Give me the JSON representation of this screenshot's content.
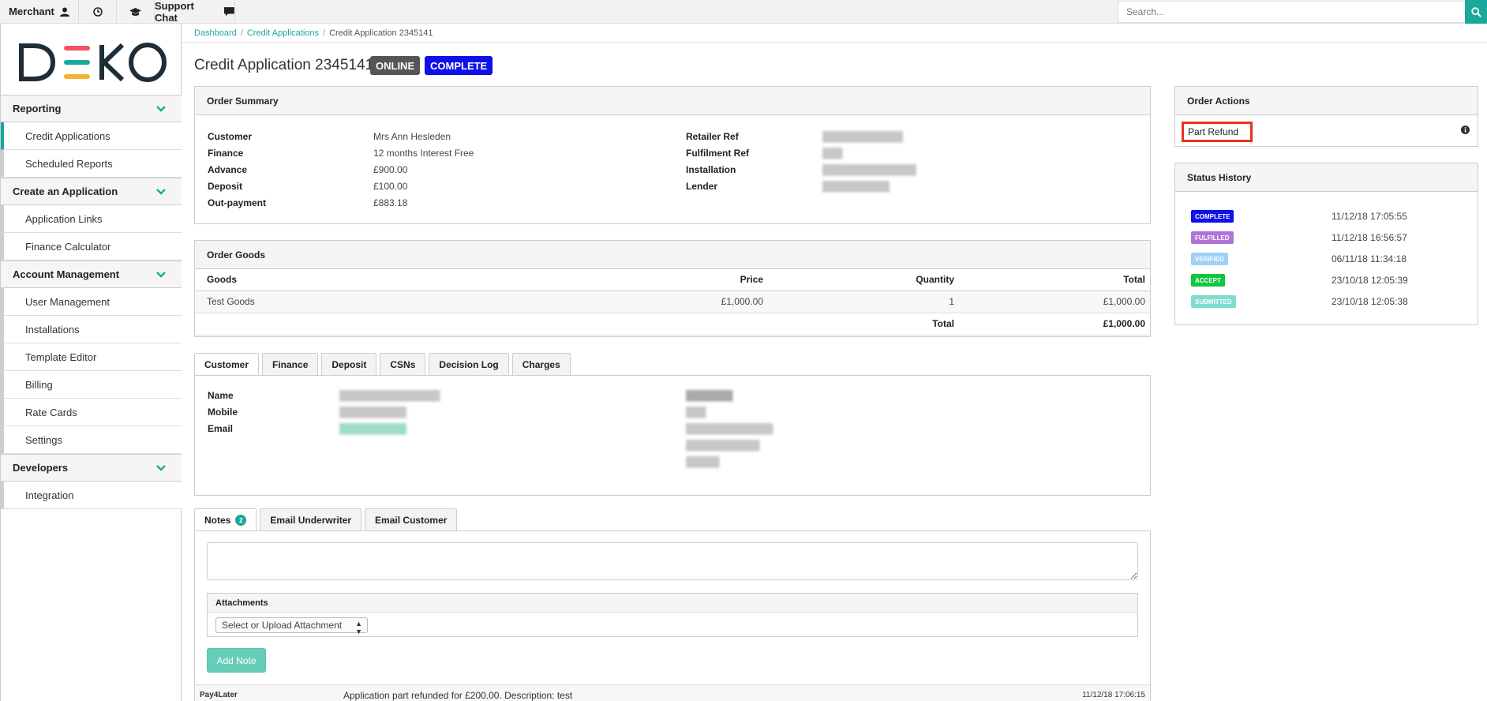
{
  "topbar": {
    "merchant_label": "Merchant",
    "support_chat_label": "Support Chat",
    "search_placeholder": "Search..."
  },
  "sidebar": {
    "logo_text": "DEKO",
    "groups": [
      {
        "label": "Reporting",
        "items": [
          "Credit Applications",
          "Scheduled Reports"
        ]
      },
      {
        "label": "Create an Application",
        "items": [
          "Application Links",
          "Finance Calculator"
        ]
      },
      {
        "label": "Account Management",
        "items": [
          "User Management",
          "Installations",
          "Template Editor",
          "Billing",
          "Rate Cards",
          "Settings"
        ]
      },
      {
        "label": "Developers",
        "items": [
          "Integration"
        ]
      }
    ],
    "active_item": "Credit Applications"
  },
  "breadcrumb": {
    "items": [
      "Dashboard",
      "Credit Applications",
      "Credit Application 2345141"
    ],
    "separator": "/"
  },
  "page": {
    "title": "Credit Application 2345141",
    "badges": [
      "ONLINE",
      "COMPLETE"
    ]
  },
  "order_summary": {
    "title": "Order Summary",
    "left": [
      {
        "label": "Customer",
        "value": "Mrs Ann Hesleden"
      },
      {
        "label": "Finance",
        "value": "12 months Interest Free"
      },
      {
        "label": "Advance",
        "value": "£900.00"
      },
      {
        "label": "Deposit",
        "value": "£100.00"
      },
      {
        "label": "Out-payment",
        "value": "£883.18"
      }
    ],
    "right": [
      {
        "label": "Retailer Ref"
      },
      {
        "label": "Fulfilment Ref"
      },
      {
        "label": "Installation"
      },
      {
        "label": "Lender"
      }
    ]
  },
  "order_goods": {
    "title": "Order Goods",
    "columns": [
      "Goods",
      "Price",
      "Quantity",
      "Total"
    ],
    "rows": [
      {
        "goods": "Test Goods",
        "price": "£1,000.00",
        "quantity": "1",
        "total": "£1,000.00"
      }
    ],
    "footer": {
      "label": "Total",
      "value": "£1,000.00"
    }
  },
  "detail_tabs": [
    "Customer",
    "Finance",
    "Deposit",
    "CSNs",
    "Decision Log",
    "Charges"
  ],
  "customer": {
    "labels": [
      "Name",
      "Mobile",
      "Email"
    ]
  },
  "notes_tabs": {
    "notes_label": "Notes",
    "notes_count": "2",
    "email_underwriter": "Email Underwriter",
    "email_customer": "Email Customer"
  },
  "notes_form": {
    "attachments_label": "Attachments",
    "attachment_select": "Select or Upload Attachment",
    "add_note_label": "Add Note"
  },
  "note_entry": {
    "author": "Pay4Later",
    "text": "Application part refunded for £200.00. Description: test",
    "timestamp": "11/12/18 17:06:15"
  },
  "order_actions": {
    "title": "Order Actions",
    "part_refund_label": "Part Refund"
  },
  "status_history": {
    "title": "Status History",
    "entries": [
      {
        "status": "COMPLETE",
        "time": "11/12/18 17:05:55",
        "color": "#1010e8"
      },
      {
        "status": "FULFILLED",
        "time": "11/12/18 16:56:57",
        "color": "#b074d6"
      },
      {
        "status": "VERIFIED",
        "time": "06/11/18 11:34:18",
        "color": "#9fd0f5"
      },
      {
        "status": "ACCEPT",
        "time": "23/10/18 12:05:39",
        "color": "#12c63d"
      },
      {
        "status": "SUBMITTED",
        "time": "23/10/18 12:05:38",
        "color": "#7fdccf"
      }
    ]
  },
  "colors": {
    "accent": "#1aa89c",
    "complete_badge": "#1010e8",
    "online_badge": "#555555",
    "part_refund_highlight": "#e8321e"
  }
}
